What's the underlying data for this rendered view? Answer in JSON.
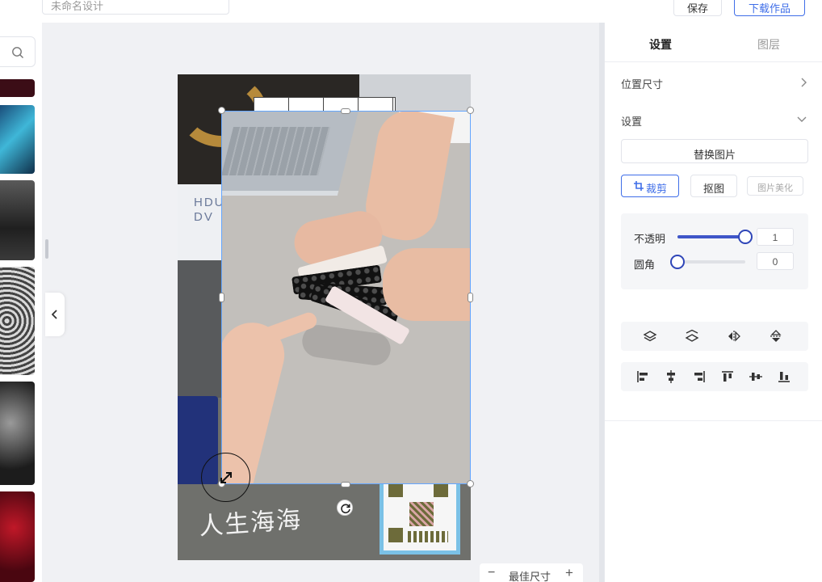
{
  "topbar": {
    "doc_title": "未命名设计",
    "save_label": "保存",
    "download_label": "下载作品"
  },
  "left_strip": {
    "search_icon": "search-icon",
    "collapse_icon": "chevron-left-icon"
  },
  "canvas": {
    "bg_text_hdu": "HDU\nDV",
    "bg_script_text": "人生海海"
  },
  "zoom": {
    "minus": "−",
    "label": "最佳尺寸",
    "plus": "+"
  },
  "panel": {
    "tabs": [
      {
        "label": "设置",
        "active": true
      },
      {
        "label": "图层",
        "active": false
      }
    ],
    "position_size_label": "位置尺寸",
    "settings_label": "设置",
    "replace_image_label": "替换图片",
    "crop_label": "裁剪",
    "cutout_label": "抠图",
    "beautify_label": "图片美化",
    "opacity": {
      "label": "不透明",
      "value": "1",
      "fraction": 1.0
    },
    "corner_radius": {
      "label": "圆角",
      "value": "0",
      "fraction": 0.0
    },
    "layer_tools": [
      "layer-up-icon",
      "layer-down-icon",
      "flip-horizontal-icon",
      "flip-vertical-icon"
    ],
    "align_tools": [
      "align-left-icon",
      "align-center-h-icon",
      "align-right-icon",
      "align-top-icon",
      "align-middle-v-icon",
      "align-bottom-icon"
    ]
  },
  "colors": {
    "accent": "#3f6ee8",
    "slider": "#2f46b8",
    "selection": "#64a6ff"
  }
}
